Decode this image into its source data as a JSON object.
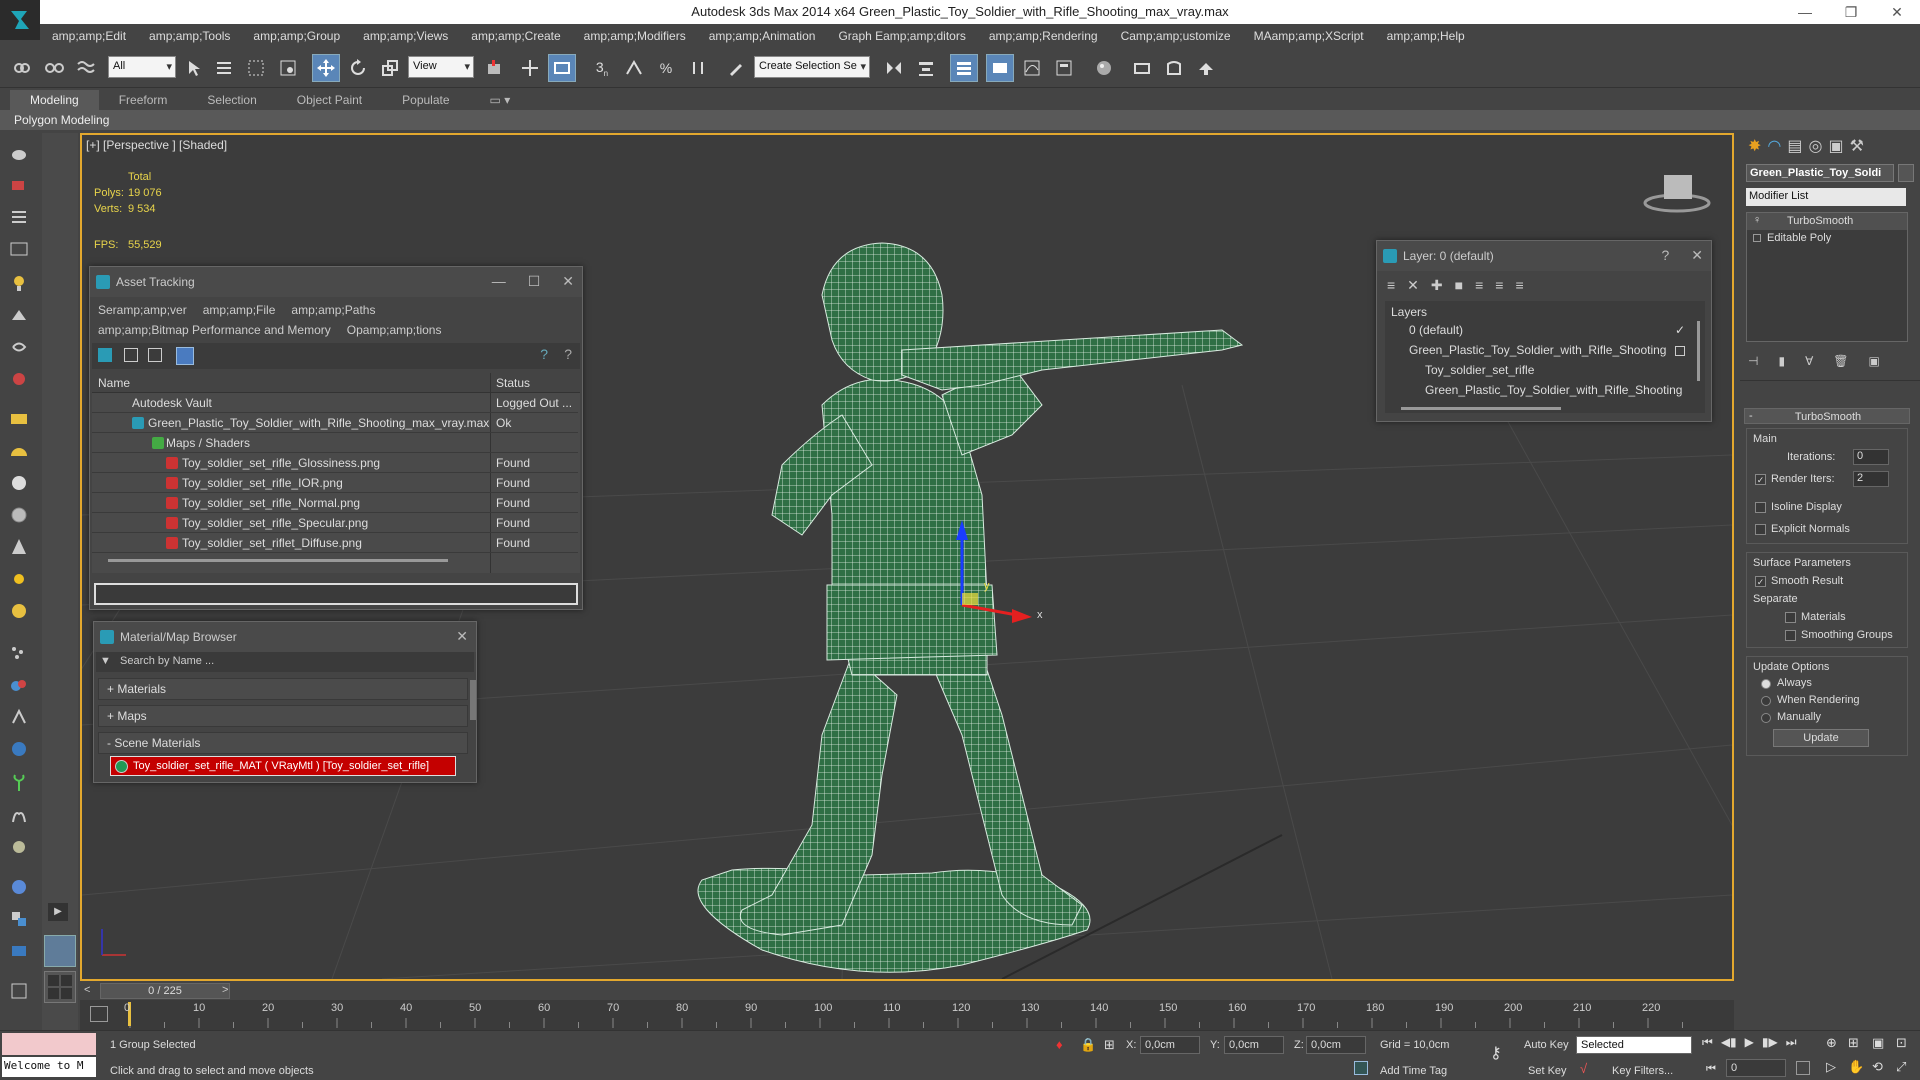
{
  "window": {
    "title": "Autodesk 3ds Max  2014 x64     Green_Plastic_Toy_Soldier_with_Rifle_Shooting_max_vray.max"
  },
  "menu": [
    "amp;amp;Edit",
    "amp;amp;Tools",
    "amp;amp;Group",
    "amp;amp;Views",
    "amp;amp;Create",
    "amp;amp;Modifiers",
    "amp;amp;Animation",
    "Graph Eamp;amp;ditors",
    "amp;amp;Rendering",
    "Camp;amp;ustomize",
    "MAamp;amp;XScript",
    "amp;amp;Help"
  ],
  "toolbar": {
    "selection_filter": "All",
    "ref_coord": "View",
    "named_selection": "Create Selection Se"
  },
  "ribbon": {
    "tabs": [
      "Modeling",
      "Freeform",
      "Selection",
      "Object Paint",
      "Populate"
    ],
    "active": "Modeling",
    "subtitle": "Polygon Modeling"
  },
  "viewport": {
    "label": "[+] [Perspective ] [Shaded]",
    "stats_total": "Total",
    "polys_label": "Polys:",
    "polys_value": "19 076",
    "verts_label": "Verts:",
    "verts_value": "9 534",
    "fps_label": "FPS:",
    "fps_value": "55,529",
    "gizmo_x": "x",
    "gizmo_y": "y"
  },
  "asset_tracking": {
    "title": "Asset Tracking",
    "menu1": [
      "Seramp;amp;ver",
      "amp;amp;File",
      "amp;amp;Paths"
    ],
    "menu2": [
      "amp;amp;Bitmap Performance and Memory",
      "Opamp;amp;tions"
    ],
    "col_name": "Name",
    "col_status": "Status",
    "rows": [
      {
        "name": "Autodesk Vault",
        "status": "Logged Out ..."
      },
      {
        "name": "Green_Plastic_Toy_Soldier_with_Rifle_Shooting_max_vray.max",
        "status": "Ok"
      },
      {
        "name": "Maps / Shaders",
        "status": ""
      },
      {
        "name": "Toy_soldier_set_rifle_Glossiness.png",
        "status": "Found"
      },
      {
        "name": "Toy_soldier_set_rifle_IOR.png",
        "status": "Found"
      },
      {
        "name": "Toy_soldier_set_rifle_Normal.png",
        "status": "Found"
      },
      {
        "name": "Toy_soldier_set_rifle_Specular.png",
        "status": "Found"
      },
      {
        "name": "Toy_soldier_set_riflet_Diffuse.png",
        "status": "Found"
      }
    ]
  },
  "material_browser": {
    "title": "Material/Map Browser",
    "search_placeholder": "Search by Name ...",
    "groups": [
      "+ Materials",
      "+ Maps",
      "- Scene Materials"
    ],
    "selected_material": "Toy_soldier_set_rifle_MAT ( VRayMtl ) [Toy_soldier_set_rifle]"
  },
  "layer_panel": {
    "title": "Layer: 0 (default)",
    "header": "Layers",
    "items": [
      "0 (default)",
      "Green_Plastic_Toy_Soldier_with_Rifle_Shooting",
      "Toy_soldier_set_rifle",
      "Green_Plastic_Toy_Soldier_with_Rifle_Shooting"
    ]
  },
  "command_panel": {
    "object_name": "Green_Plastic_Toy_Soldi",
    "modifier_list": "Modifier List",
    "stack": [
      "TurboSmooth",
      "Editable Poly"
    ],
    "rollout_title": "TurboSmooth",
    "main": "Main",
    "iterations_label": "Iterations:",
    "iterations_value": "0",
    "render_iters_label": "Render Iters:",
    "render_iters_value": "2",
    "isoline": "Isoline Display",
    "explicit": "Explicit Normals",
    "surface_params": "Surface Parameters",
    "smooth_result": "Smooth Result",
    "separate": "Separate",
    "materials": "Materials",
    "smoothing_groups": "Smoothing Groups",
    "update_options": "Update Options",
    "always": "Always",
    "when_rendering": "When Rendering",
    "manually": "Manually",
    "update_button": "Update"
  },
  "timeline": {
    "frame_counter": "0 / 225",
    "ticks": [
      "0",
      "10",
      "20",
      "30",
      "40",
      "50",
      "60",
      "70",
      "80",
      "90",
      "100",
      "110",
      "120",
      "130",
      "140",
      "150",
      "160",
      "170",
      "180",
      "190",
      "200",
      "210",
      "220"
    ]
  },
  "status": {
    "welcome": "Welcome to M",
    "selected": "1 Group Selected",
    "prompt": "Click and drag to select and move objects",
    "x_label": "X:",
    "x_value": "0,0cm",
    "y_label": "Y:",
    "y_value": "0,0cm",
    "z_label": "Z:",
    "z_value": "0,0cm",
    "grid": "Grid = 10,0cm",
    "add_time_tag": "Add Time Tag",
    "auto_key": "Auto Key",
    "auto_key_value": "Selected",
    "set_key": "Set Key",
    "key_filters": "Key Filters...",
    "frame_field": "0"
  },
  "colors": {
    "accent": "#e3a82e",
    "wireframe": "#2e8b57",
    "selection": "#cc0000"
  }
}
